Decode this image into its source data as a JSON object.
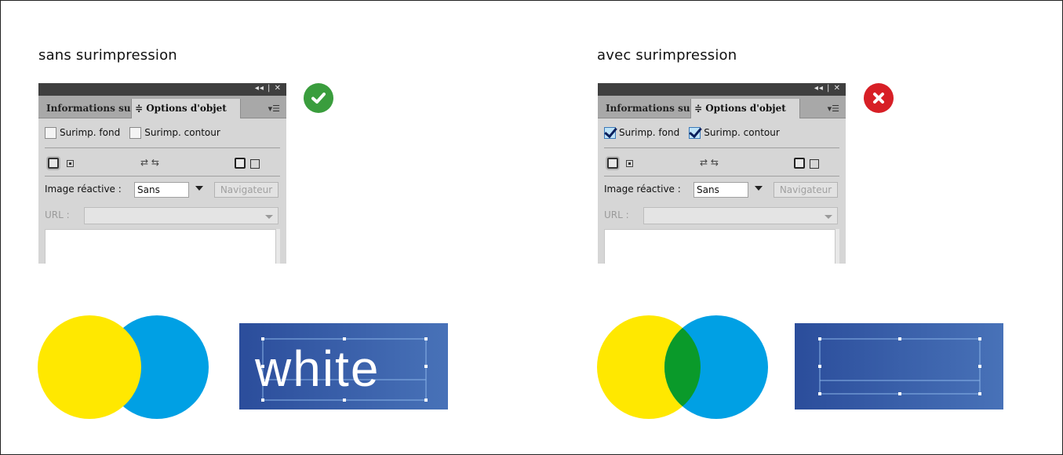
{
  "colors": {
    "yellow": "#ffe800",
    "cyan": "#00a0e4",
    "green_overlap": "#0a9a2a",
    "check_badge": "#3a9d3d",
    "cross_badge": "#d71f26",
    "panel_bg": "#d6d6d6",
    "blue_rect_left": "#2b4d9b",
    "blue_rect_right": "#4872b8"
  },
  "left": {
    "title": "sans surimpression",
    "badge_icon": "check-icon",
    "panel": {
      "tab_inactive": "Informations su",
      "tab_active": "≑ Options d'objet",
      "menu_icon": "panel-menu-icon",
      "topbar_controls": "◂◂ | ✕",
      "checkbox_fond_label": "Surimp. fond",
      "checkbox_contour_label": "Surimp. contour",
      "checkbox_fond_checked": false,
      "checkbox_contour_checked": false,
      "image_reactive_label": "Image réactive :",
      "image_reactive_value": "Sans",
      "navigator_button": "Navigateur",
      "url_label": "URL :",
      "url_value": ""
    },
    "sample_text": "white"
  },
  "right": {
    "title": "avec surimpression",
    "badge_icon": "cross-icon",
    "panel": {
      "tab_inactive": "Informations su",
      "tab_active": "≑ Options d'objet",
      "menu_icon": "panel-menu-icon",
      "topbar_controls": "◂◂ | ✕",
      "checkbox_fond_label": "Surimp. fond",
      "checkbox_contour_label": "Surimp. contour",
      "checkbox_fond_checked": true,
      "checkbox_contour_checked": true,
      "image_reactive_label": "Image réactive :",
      "image_reactive_value": "Sans",
      "navigator_button": "Navigateur",
      "url_label": "URL :",
      "url_value": ""
    },
    "sample_text": ""
  }
}
